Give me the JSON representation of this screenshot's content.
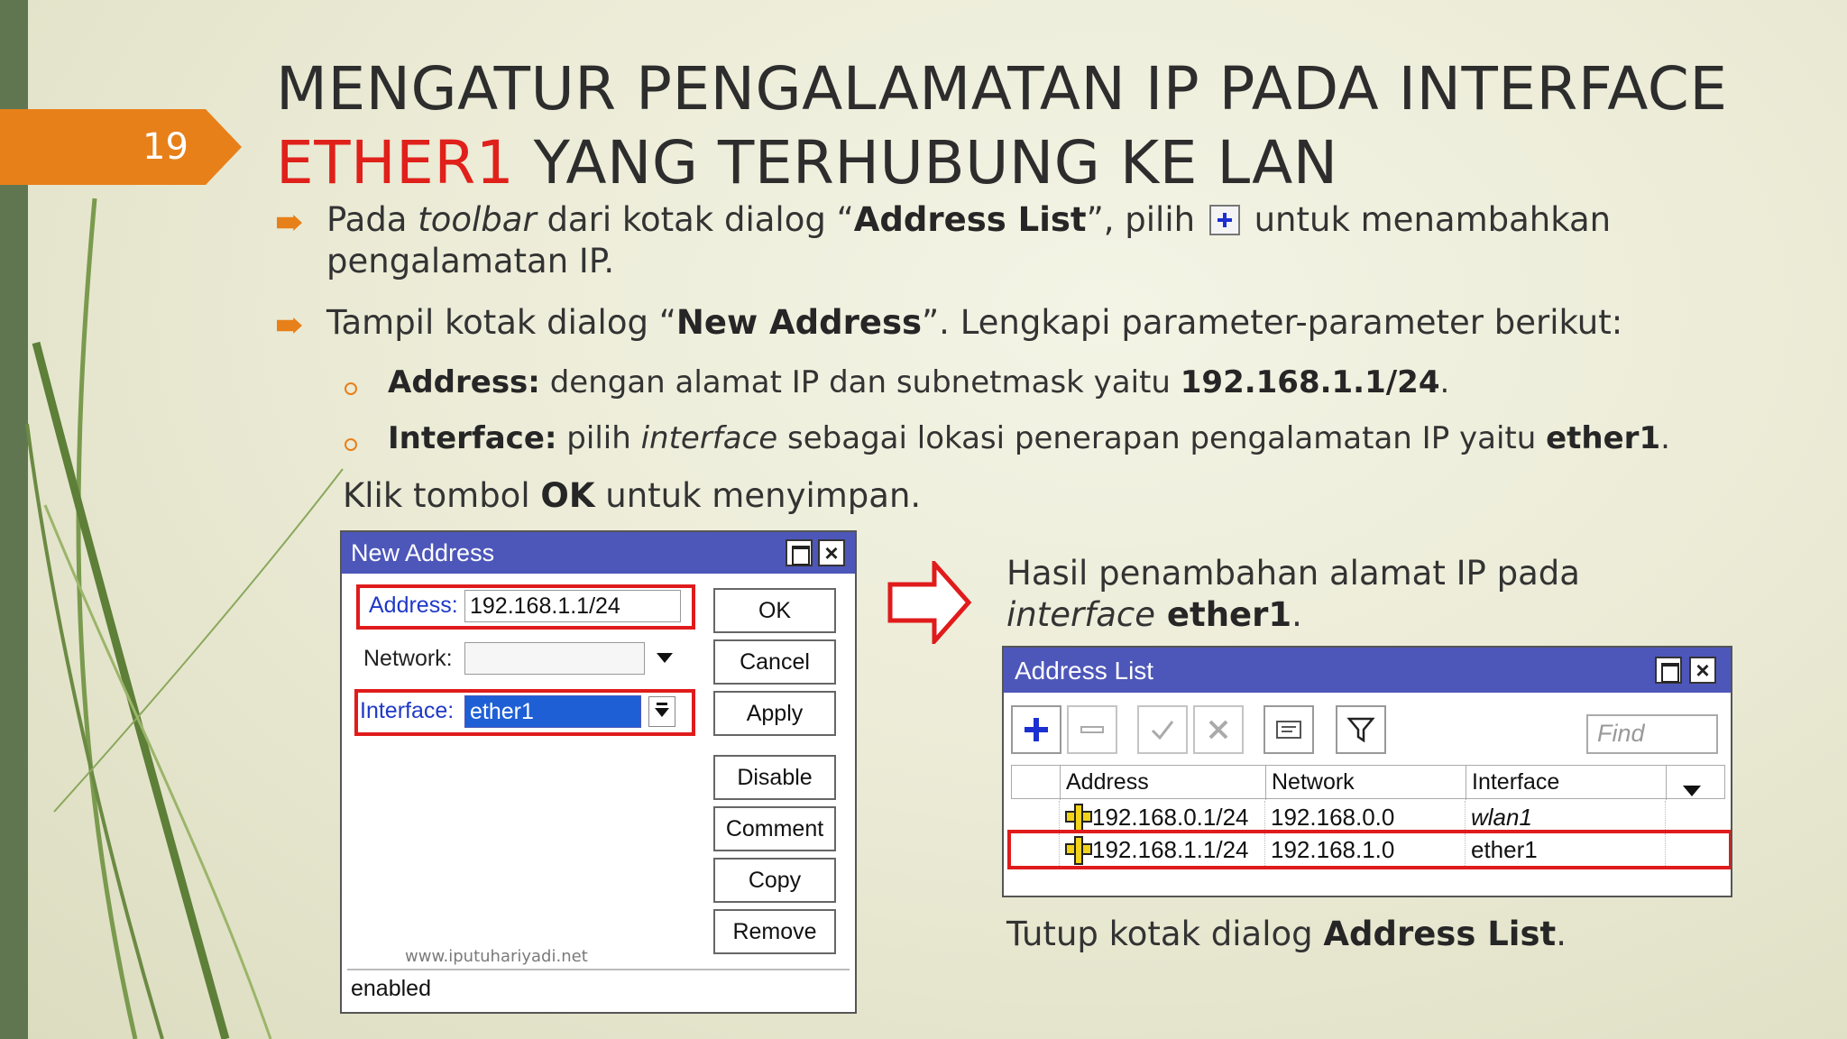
{
  "slide": {
    "page_number": "19",
    "title_line1": "MENGATUR PENGALAMATAN IP PADA INTERFACE",
    "title_red": "ETHER1",
    "title_line2_rest": " YANG TERHUBUNG KE LAN",
    "colors": {
      "accent": "#e8801a",
      "red": "#e0201a",
      "sidebar": "#5f7650",
      "titlebar": "#4d57b9"
    }
  },
  "bullets": {
    "b1_pre": "Pada ",
    "b1_italic": "toolbar",
    "b1_mid": " dari kotak dialog “",
    "b1_bold": "Address List",
    "b1_post": "”, pilih",
    "b1_icon": "plus-icon",
    "b1_end": "untuk menambahkan",
    "b1_line2": "pengalamatan IP.",
    "b2_pre": "Tampil kotak dialog “",
    "b2_bold": "New Address",
    "b2_post": "”. Lengkapi parameter-parameter berikut:",
    "s1_bold": "Address:",
    "s1_text": " dengan alamat IP dan subnetmask yaitu ",
    "s1_value": "192.168.1.1/24",
    "s1_end": ".",
    "s2_bold": "Interface:",
    "s2_text": " pilih ",
    "s2_italic": "interface",
    "s2_text2": " sebagai lokasi penerapan pengalamatan IP yaitu ",
    "s2_value": "ether1",
    "s2_end": ".",
    "klik_pre": "Klik tombol ",
    "klik_bold": "OK",
    "klik_post": " untuk menyimpan."
  },
  "new_address": {
    "title": "New Address",
    "address_label": "Address:",
    "address_value": "192.168.1.1/24",
    "network_label": "Network:",
    "network_value": "",
    "interface_label": "Interface:",
    "interface_value": "ether1",
    "buttons": [
      "OK",
      "Cancel",
      "Apply",
      "Disable",
      "Comment",
      "Copy",
      "Remove"
    ],
    "watermark": "www.iputuhariyadi.net",
    "status": "enabled"
  },
  "result": {
    "line1": "Hasil penambahan alamat IP pada",
    "line2_italic": "interface",
    "line2_bold": " ether1",
    "line2_end": ".",
    "closing_pre": "Tutup kotak dialog ",
    "closing_bold": "Address List",
    "closing_end": "."
  },
  "address_list": {
    "title": "Address List",
    "find_placeholder": "Find",
    "toolbar_icons": [
      "add-icon",
      "remove-icon",
      "enable-icon",
      "disable-icon",
      "comment-icon",
      "filter-icon"
    ],
    "columns": [
      "Address",
      "Network",
      "Interface"
    ],
    "rows": [
      {
        "address": "192.168.0.1/24",
        "network": "192.168.0.0",
        "interface": "wlan1"
      },
      {
        "address": "192.168.1.1/24",
        "network": "192.168.1.0",
        "interface": "ether1"
      }
    ]
  }
}
